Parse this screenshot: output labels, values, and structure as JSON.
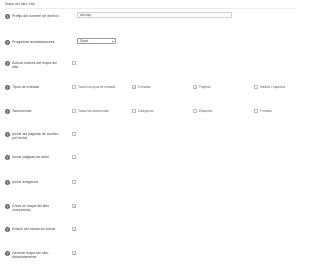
{
  "header": {
    "title": "Mapa del sitio XML"
  },
  "icons": {
    "help": "help-circle-icon",
    "check": "check-icon",
    "dropdown": "chevron-down-icon"
  },
  "colors": {
    "help_bg": "#5f6468",
    "checkmark": "#2a6fd0"
  },
  "settings": {
    "file_prefix": {
      "label": "Prefijo del nombre de archivo",
      "value": "sitemap",
      "help": "?"
    },
    "schedule": {
      "label": "Programar actualizaciones",
      "value": "Diario",
      "help": "?"
    },
    "include_noindex": {
      "label": "Activar índices del mapa del sitio",
      "checked": false,
      "help": "?"
    },
    "post_types": {
      "label": "Tipos de entrada",
      "help": "?",
      "options": [
        {
          "label": "Todos los tipos de entrada",
          "checked": false
        },
        {
          "label": "Entradas",
          "checked": true
        },
        {
          "label": "Páginas",
          "checked": true
        },
        {
          "label": "Medios / Adjuntos",
          "checked": false
        }
      ]
    },
    "taxonomies": {
      "label": "Taxonomías",
      "help": "?",
      "options": [
        {
          "label": "Todas las taxonomías",
          "checked": false
        },
        {
          "label": "Categorías",
          "checked": false
        },
        {
          "label": "Etiquetas",
          "checked": false
        },
        {
          "label": "Formato",
          "checked": false
        }
      ]
    },
    "date_archives": {
      "label": "Incluir las páginas de archivo por fecha",
      "checked": false,
      "help": "?"
    },
    "author_pages": {
      "label": "Incluir páginas de autor",
      "checked": false,
      "help": "?"
    },
    "images": {
      "label": "Incluir imágenes",
      "checked": false,
      "help": "?"
    },
    "compressed": {
      "label": "Crear un mapa del sitio comprimido",
      "checked": true,
      "help": "?"
    },
    "robots": {
      "label": "Enlace del robots.txt virtual",
      "checked": true,
      "help": "?"
    },
    "dynamic": {
      "label": "Generar mapa del sitio dinámicamente",
      "checked": true,
      "help": "?"
    }
  }
}
